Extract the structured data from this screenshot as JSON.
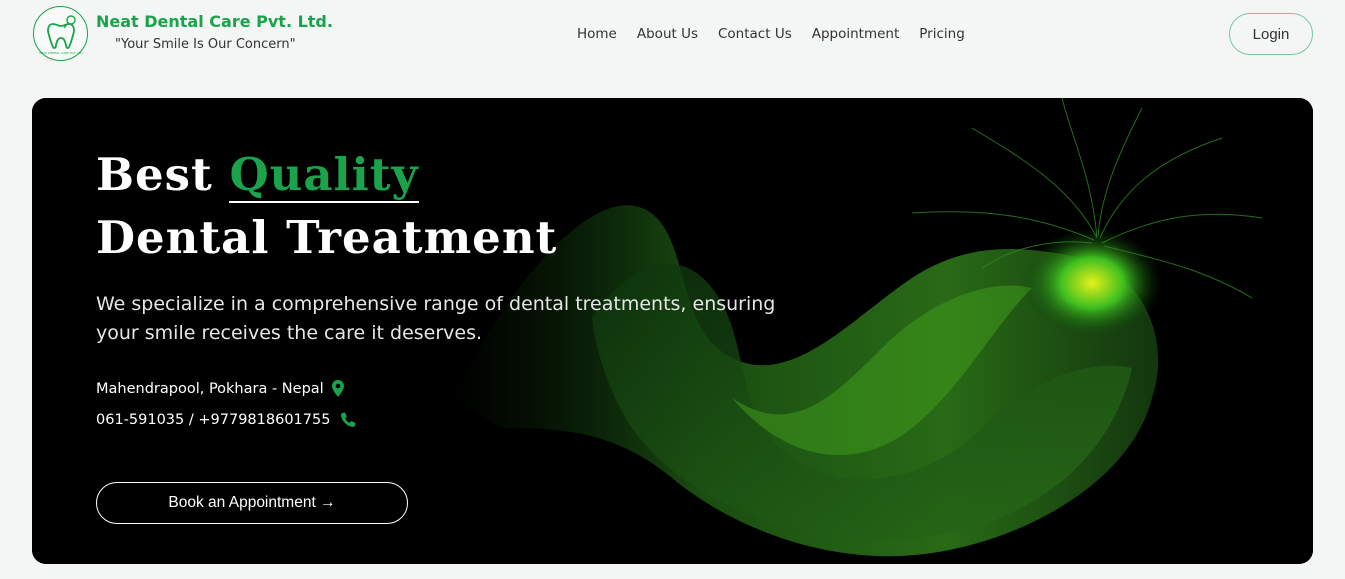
{
  "brand": {
    "name": "Neat Dental Care Pvt. Ltd.",
    "tagline": "\"Your Smile Is Our Concern\"",
    "logo_text": "NEAT DENTAL CARE PVT. LTD."
  },
  "nav": {
    "items": [
      "Home",
      "About Us",
      "Contact Us",
      "Appointment",
      "Pricing"
    ]
  },
  "login_label": "Login",
  "hero": {
    "headline_prefix": "Best ",
    "headline_accent": "Quality",
    "headline_line2": "Dental Treatment",
    "description": "We specialize in a comprehensive range of dental treatments, ensuring your smile receives the care it deserves.",
    "address": "Mahendrapool, Pokhara - Nepal",
    "phone": "061-591035 / +9779818601755",
    "cta_label": "Book an Appointment →"
  },
  "colors": {
    "brand_green": "#1aa34a",
    "background": "#f3f6f4",
    "hero_background": "#000000"
  },
  "icons": [
    "tooth-logo-icon",
    "map-pin-icon",
    "phone-icon",
    "arrow-right-icon"
  ]
}
